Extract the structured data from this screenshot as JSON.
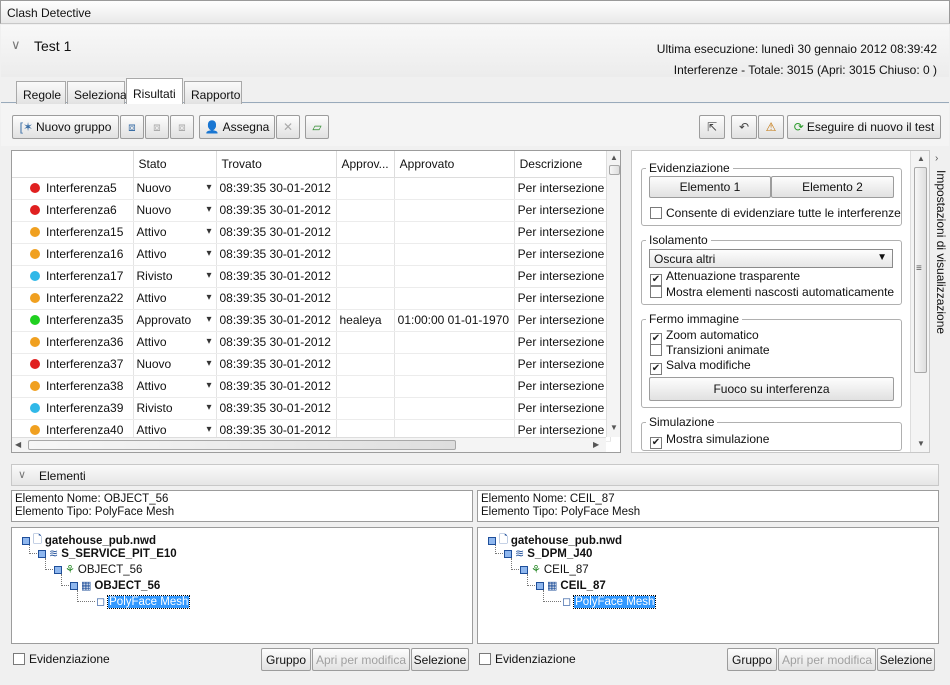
{
  "window": {
    "title": "Clash Detective"
  },
  "header": {
    "test_name": "Test 1",
    "last_run": "Ultima esecuzione:  lunedì 30 gennaio 2012 08:39:42",
    "summary": "Interferenze -  Totale:  3015  (Apri:  3015  Chiuso:  0 )"
  },
  "tabs": [
    "Regole",
    "Seleziona",
    "Risultati",
    "Rapporto"
  ],
  "toolbar": {
    "new_group": "Nuovo gruppo",
    "assign": "Assegna",
    "rerun": "Eseguire di nuovo il test"
  },
  "grid": {
    "columns": [
      "",
      "Stato",
      "Trovato",
      "Approv...",
      "Approvato",
      "Descrizione"
    ],
    "rows": [
      {
        "name": "Interferenza5",
        "color": "#e02020",
        "status": "Nuovo",
        "found": "08:39:35 30-01-2012",
        "approver": "",
        "approved": "",
        "desc": "Per intersezione"
      },
      {
        "name": "Interferenza6",
        "color": "#e02020",
        "status": "Nuovo",
        "found": "08:39:35 30-01-2012",
        "approver": "",
        "approved": "",
        "desc": "Per intersezione"
      },
      {
        "name": "Interferenza15",
        "color": "#f0a020",
        "status": "Attivo",
        "found": "08:39:35 30-01-2012",
        "approver": "",
        "approved": "",
        "desc": "Per intersezione"
      },
      {
        "name": "Interferenza16",
        "color": "#f0a020",
        "status": "Attivo",
        "found": "08:39:35 30-01-2012",
        "approver": "",
        "approved": "",
        "desc": "Per intersezione"
      },
      {
        "name": "Interferenza17",
        "color": "#30b8e8",
        "status": "Rivisto",
        "found": "08:39:35 30-01-2012",
        "approver": "",
        "approved": "",
        "desc": "Per intersezione"
      },
      {
        "name": "Interferenza22",
        "color": "#f0a020",
        "status": "Attivo",
        "found": "08:39:35 30-01-2012",
        "approver": "",
        "approved": "",
        "desc": "Per intersezione"
      },
      {
        "name": "Interferenza35",
        "color": "#20d020",
        "status": "Approvato",
        "found": "08:39:35 30-01-2012",
        "approver": "healeya",
        "approved": "01:00:00 01-01-1970",
        "desc": "Per intersezione"
      },
      {
        "name": "Interferenza36",
        "color": "#f0a020",
        "status": "Attivo",
        "found": "08:39:35 30-01-2012",
        "approver": "",
        "approved": "",
        "desc": "Per intersezione"
      },
      {
        "name": "Interferenza37",
        "color": "#e02020",
        "status": "Nuovo",
        "found": "08:39:35 30-01-2012",
        "approver": "",
        "approved": "",
        "desc": "Per intersezione"
      },
      {
        "name": "Interferenza38",
        "color": "#f0a020",
        "status": "Attivo",
        "found": "08:39:35 30-01-2012",
        "approver": "",
        "approved": "",
        "desc": "Per intersezione"
      },
      {
        "name": "Interferenza39",
        "color": "#30b8e8",
        "status": "Rivisto",
        "found": "08:39:35 30-01-2012",
        "approver": "",
        "approved": "",
        "desc": "Per intersezione"
      },
      {
        "name": "Interferenza40",
        "color": "#f0a020",
        "status": "Attivo",
        "found": "08:39:35 30-01-2012",
        "approver": "",
        "approved": "",
        "desc": "Per intersezione"
      }
    ]
  },
  "settings": {
    "highlight": {
      "title": "Evidenziazione",
      "item1": "Elemento 1",
      "item2": "Elemento 2",
      "all": "Consente di evidenziare tutte le interferenze"
    },
    "isolation": {
      "title": "Isolamento",
      "mode": "Oscura altri",
      "transparent": "Attenuazione trasparente",
      "show_hidden": "Mostra elementi nascosti automaticamente"
    },
    "viewpoint": {
      "title": "Fermo immagine",
      "auto_zoom": "Zoom automatico",
      "animated": "Transizioni animate",
      "save_changes": "Salva modifiche",
      "focus": "Fuoco su interferenza"
    },
    "simulation": {
      "title": "Simulazione",
      "show": "Mostra simulazione"
    },
    "side_tab": "Impostazioni di visualizzazione"
  },
  "elements": {
    "header": "Elementi",
    "left": {
      "name_line": "Elemento Nome: OBJECT_56",
      "type_line": "Elemento Tipo: PolyFace Mesh",
      "tree": [
        "gatehouse_pub.nwd",
        "S_SERVICE_PIT_E10",
        "OBJECT_56",
        "OBJECT_56",
        "PolyFace Mesh"
      ]
    },
    "right": {
      "name_line": "Elemento Nome: CEIL_87",
      "type_line": "Elemento Tipo: PolyFace Mesh",
      "tree": [
        "gatehouse_pub.nwd",
        "S_DPM_J40",
        "CEIL_87",
        "CEIL_87",
        "PolyFace Mesh"
      ]
    },
    "highlight": "Evidenziazione",
    "group": "Gruppo",
    "open_edit": "Apri per modifica",
    "select": "Selezione"
  }
}
